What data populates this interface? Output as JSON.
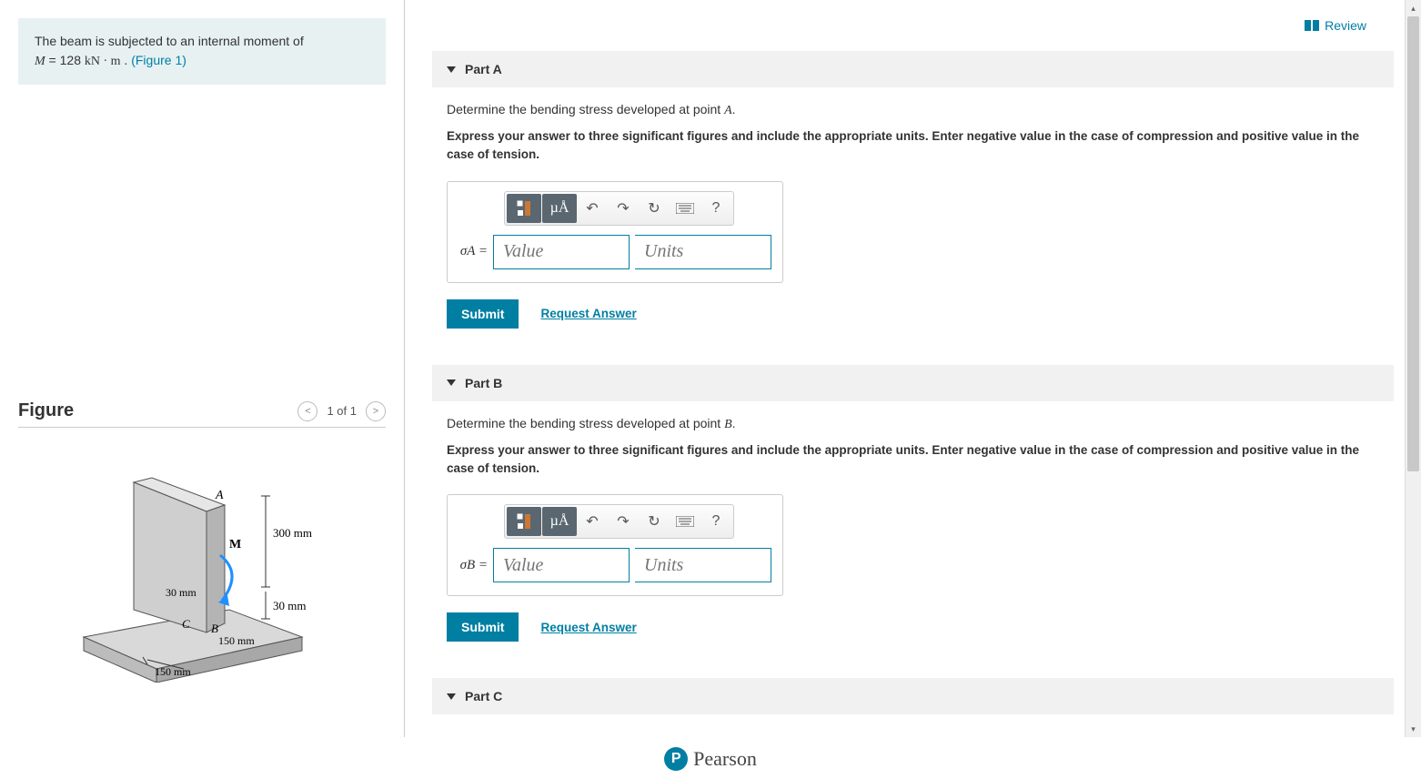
{
  "problem": {
    "intro_prefix": "The beam is subjected to an internal moment of",
    "moment_var": "M",
    "moment_eq": " = 128 ",
    "moment_units": "kN · m",
    "period": " . ",
    "figure_link": "(Figure 1)"
  },
  "figure": {
    "title": "Figure",
    "nav_text": "1 of 1",
    "labels": {
      "A": "A",
      "B": "B",
      "C": "C",
      "M": "M",
      "d300": "300 mm",
      "d30a": "30 mm",
      "d30b": "30 mm",
      "d150a": "150 mm",
      "d150b": "150 mm"
    }
  },
  "review_label": "Review",
  "parts": [
    {
      "title": "Part A",
      "prompt_pre": "Determine the bending stress developed at point ",
      "prompt_pt": "A",
      "prompt_post": ".",
      "instructions": "Express your answer to three significant figures and include the appropriate units. Enter negative value in the case of compression and positive value in the case of tension.",
      "sigma_label": "σA =",
      "value_ph": "Value",
      "units_ph": "Units",
      "submit": "Submit",
      "request": "Request Answer"
    },
    {
      "title": "Part B",
      "prompt_pre": "Determine the bending stress developed at point ",
      "prompt_pt": "B",
      "prompt_post": ".",
      "instructions": "Express your answer to three significant figures and include the appropriate units. Enter negative value in the case of compression and positive value in the case of tension.",
      "sigma_label": "σB =",
      "value_ph": "Value",
      "units_ph": "Units",
      "submit": "Submit",
      "request": "Request Answer"
    },
    {
      "title": "Part C"
    }
  ],
  "toolbar": {
    "mu_label": "µÅ",
    "help": "?"
  },
  "footer": {
    "brand": "Pearson"
  }
}
